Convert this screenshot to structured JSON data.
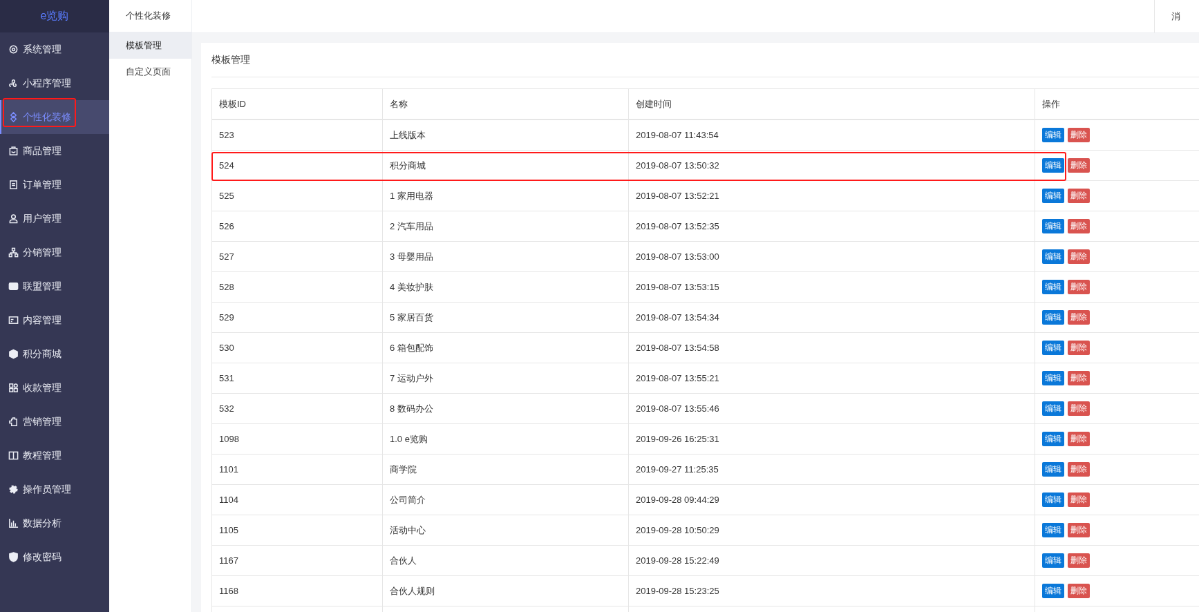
{
  "logo": "e览购",
  "sidebar": {
    "items": [
      {
        "label": "系统管理",
        "selected": false,
        "annotated": false
      },
      {
        "label": "小程序管理",
        "selected": false,
        "annotated": false
      },
      {
        "label": "个性化装修",
        "selected": true,
        "annotated": true
      },
      {
        "label": "商品管理",
        "selected": false,
        "annotated": false
      },
      {
        "label": "订单管理",
        "selected": false,
        "annotated": false
      },
      {
        "label": "用户管理",
        "selected": false,
        "annotated": false
      },
      {
        "label": "分销管理",
        "selected": false,
        "annotated": false
      },
      {
        "label": "联盟管理",
        "selected": false,
        "annotated": false
      },
      {
        "label": "内容管理",
        "selected": false,
        "annotated": false
      },
      {
        "label": "积分商城",
        "selected": false,
        "annotated": false
      },
      {
        "label": "收款管理",
        "selected": false,
        "annotated": false
      },
      {
        "label": "营销管理",
        "selected": false,
        "annotated": false
      },
      {
        "label": "教程管理",
        "selected": false,
        "annotated": false
      },
      {
        "label": "操作员管理",
        "selected": false,
        "annotated": false
      },
      {
        "label": "数据分析",
        "selected": false,
        "annotated": false
      },
      {
        "label": "修改密码",
        "selected": false,
        "annotated": false
      }
    ]
  },
  "submenu": {
    "title": "个性化装修",
    "items": [
      {
        "label": "模板管理",
        "selected": true
      },
      {
        "label": "自定义页面",
        "selected": false
      }
    ]
  },
  "topbar": {
    "messages": "消"
  },
  "panel": {
    "title": "模板管理"
  },
  "table": {
    "columns": [
      "模板ID",
      "名称",
      "创建时间",
      "操作"
    ],
    "rows": [
      {
        "id": "523",
        "name": "上线版本",
        "created": "2019-08-07 11:43:54",
        "edit": "编辑",
        "delete": "删除",
        "annotated": false
      },
      {
        "id": "524",
        "name": "积分商城",
        "created": "2019-08-07 13:50:32",
        "edit": "编辑",
        "delete": "删除",
        "annotated": true
      },
      {
        "id": "525",
        "name": "1 家用电器",
        "created": "2019-08-07 13:52:21",
        "edit": "编辑",
        "delete": "删除",
        "annotated": false
      },
      {
        "id": "526",
        "name": "2 汽车用品",
        "created": "2019-08-07 13:52:35",
        "edit": "编辑",
        "delete": "删除",
        "annotated": false
      },
      {
        "id": "527",
        "name": "3 母婴用品",
        "created": "2019-08-07 13:53:00",
        "edit": "编辑",
        "delete": "删除",
        "annotated": false
      },
      {
        "id": "528",
        "name": "4 美妆护肤",
        "created": "2019-08-07 13:53:15",
        "edit": "编辑",
        "delete": "删除",
        "annotated": false
      },
      {
        "id": "529",
        "name": "5 家居百货",
        "created": "2019-08-07 13:54:34",
        "edit": "编辑",
        "delete": "删除",
        "annotated": false
      },
      {
        "id": "530",
        "name": "6 箱包配饰",
        "created": "2019-08-07 13:54:58",
        "edit": "编辑",
        "delete": "删除",
        "annotated": false
      },
      {
        "id": "531",
        "name": "7 运动户外",
        "created": "2019-08-07 13:55:21",
        "edit": "编辑",
        "delete": "删除",
        "annotated": false
      },
      {
        "id": "532",
        "name": "8 数码办公",
        "created": "2019-08-07 13:55:46",
        "edit": "编辑",
        "delete": "删除",
        "annotated": false
      },
      {
        "id": "1098",
        "name": "1.0 e览购",
        "created": "2019-09-26 16:25:31",
        "edit": "编辑",
        "delete": "删除",
        "annotated": false
      },
      {
        "id": "1101",
        "name": "商学院",
        "created": "2019-09-27 11:25:35",
        "edit": "编辑",
        "delete": "删除",
        "annotated": false
      },
      {
        "id": "1104",
        "name": "公司简介",
        "created": "2019-09-28 09:44:29",
        "edit": "编辑",
        "delete": "删除",
        "annotated": false
      },
      {
        "id": "1105",
        "name": "活动中心",
        "created": "2019-09-28 10:50:29",
        "edit": "编辑",
        "delete": "删除",
        "annotated": false
      },
      {
        "id": "1167",
        "name": "合伙人",
        "created": "2019-09-28 15:22:49",
        "edit": "编辑",
        "delete": "删除",
        "annotated": false
      },
      {
        "id": "1168",
        "name": "合伙人规则",
        "created": "2019-09-28 15:23:25",
        "edit": "编辑",
        "delete": "删除",
        "annotated": false
      }
    ]
  }
}
